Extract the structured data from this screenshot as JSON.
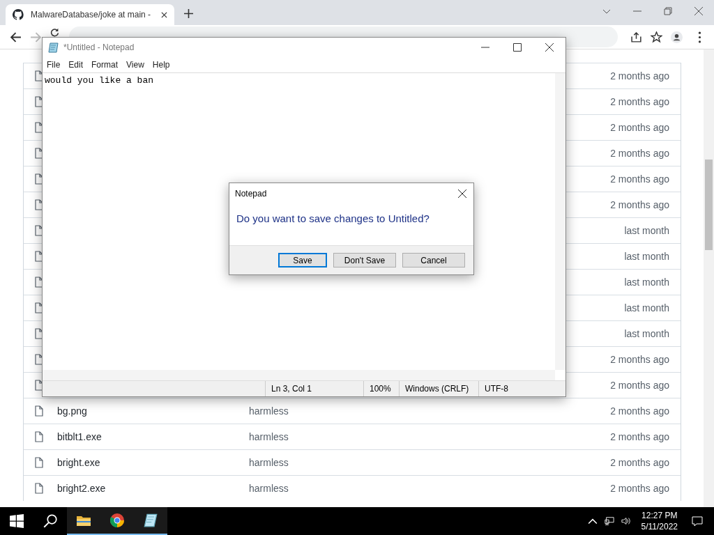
{
  "browser": {
    "tab": {
      "title": "MalwareDatabase/joke at main -"
    }
  },
  "files": [
    {
      "age": "2 months ago"
    },
    {
      "age": "2 months ago"
    },
    {
      "age": "2 months ago"
    },
    {
      "age": "2 months ago"
    },
    {
      "age": "2 months ago"
    },
    {
      "age": "2 months ago"
    },
    {
      "age": "last month"
    },
    {
      "age": "last month"
    },
    {
      "age": "last month"
    },
    {
      "age": "last month"
    },
    {
      "age": "last month"
    },
    {
      "age": "2 months ago"
    },
    {
      "age": "2 months ago"
    },
    {
      "name": "bg.png",
      "message": "harmless",
      "age": "2 months ago"
    },
    {
      "name": "bitblt1.exe",
      "message": "harmless",
      "age": "2 months ago"
    },
    {
      "name": "bright.exe",
      "message": "harmless",
      "age": "2 months ago"
    },
    {
      "name": "bright2.exe",
      "message": "harmless",
      "age": "2 months ago"
    }
  ],
  "notepad": {
    "title": "*Untitled - Notepad",
    "menu": [
      "File",
      "Edit",
      "Format",
      "View",
      "Help"
    ],
    "text": "would you like a ban",
    "status": [
      "Ln 3, Col 1",
      "100%",
      "Windows (CRLF)",
      "UTF-8"
    ]
  },
  "dialog": {
    "title": "Notepad",
    "message": "Do you want to save changes to Untitled?",
    "buttons": [
      {
        "label": "Save",
        "default": true
      },
      {
        "label": "Don't Save",
        "default": false
      },
      {
        "label": "Cancel",
        "default": false
      }
    ]
  },
  "taskbar": {
    "apps": [
      {
        "kind": "explorer",
        "running": true
      },
      {
        "kind": "chrome",
        "running": true
      },
      {
        "kind": "notepad",
        "running": true
      }
    ],
    "time": "12:27 PM",
    "date": "5/11/2022"
  }
}
